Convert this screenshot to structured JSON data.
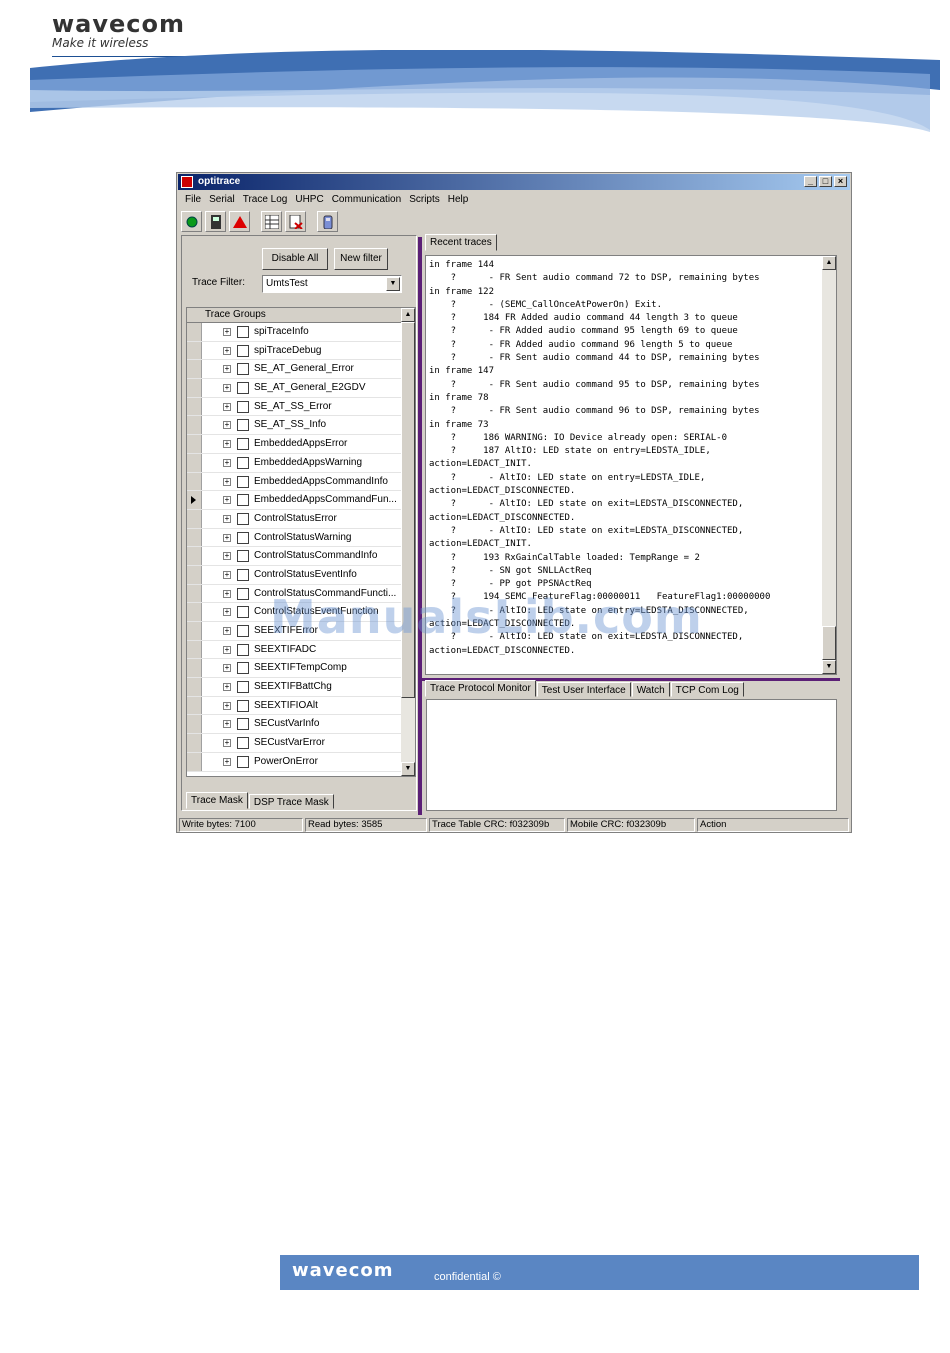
{
  "page": {
    "logo_text": "wavecom",
    "logo_tagline": "Make it wireless",
    "footer_logo": "wavecom",
    "footer_text": "confidential ©",
    "watermark": "ManualsLib.com"
  },
  "window": {
    "title": "optitrace",
    "controls": [
      "_",
      "□",
      "×"
    ],
    "menu": [
      "File",
      "Serial",
      "Trace Log",
      "UHPC",
      "Communication",
      "Scripts",
      "Help"
    ],
    "toolbar_icons": [
      "connect-icon",
      "mobile-icon",
      "warning-icon",
      "grid-icon",
      "clear-log-icon",
      "phone-icon"
    ]
  },
  "left_panel": {
    "disable_all": "Disable All",
    "new_filter": "New filter",
    "trace_filter_label": "Trace Filter:",
    "trace_filter_value": "UmtsTest",
    "tree_header": "Trace Groups",
    "groups": [
      "spiTraceInfo",
      "spiTraceDebug",
      "SE_AT_General_Error",
      "SE_AT_General_E2GDV",
      "SE_AT_SS_Error",
      "SE_AT_SS_Info",
      "EmbeddedAppsError",
      "EmbeddedAppsWarning",
      "EmbeddedAppsCommandInfo",
      "EmbeddedAppsCommandFun...",
      "ControlStatusError",
      "ControlStatusWarning",
      "ControlStatusCommandInfo",
      "ControlStatusEventInfo",
      "ControlStatusCommandFuncti...",
      "ControlStatusEventFunction",
      "SEEXTIFError",
      "SEEXTIFADC",
      "SEEXTIFTempComp",
      "SEEXTIFBattChg",
      "SEEXTIFIOAlt",
      "SECustVarInfo",
      "SECustVarError",
      "PowerOnError"
    ],
    "selected_index": 9,
    "tabs": [
      "Trace Mask",
      "DSP Trace Mask"
    ]
  },
  "right_panel": {
    "recent_tab": "Recent traces",
    "trace_lines": [
      "in frame 144",
      "    ?      - FR Sent audio command 72 to DSP, remaining bytes",
      "in frame 122",
      "    ?      - (SEMC_CallOnceAtPowerOn) Exit.",
      "    ?     184 FR Added audio command 44 length 3 to queue",
      "    ?      - FR Added audio command 95 length 69 to queue",
      "    ?      - FR Added audio command 96 length 5 to queue",
      "    ?      - FR Sent audio command 44 to DSP, remaining bytes",
      "in frame 147",
      "    ?      - FR Sent audio command 95 to DSP, remaining bytes",
      "in frame 78",
      "    ?      - FR Sent audio command 96 to DSP, remaining bytes",
      "in frame 73",
      "    ?     186 WARNING: IO Device already open: SERIAL-0",
      "    ?     187 AltIO: LED state on entry=LEDSTA_IDLE,",
      "action=LEDACT_INIT.",
      "    ?      - AltIO: LED state on entry=LEDSTA_IDLE,",
      "action=LEDACT_DISCONNECTED.",
      "    ?      - AltIO: LED state on exit=LEDSTA_DISCONNECTED,",
      "action=LEDACT_DISCONNECTED.",
      "    ?      - AltIO: LED state on exit=LEDSTA_DISCONNECTED,",
      "action=LEDACT_INIT.",
      "    ?     193 RxGainCalTable loaded: TempRange = 2",
      "    ?      - SN got SNLLActReq",
      "    ?      - PP got PPSNActReq",
      "    ?     194 SEMC FeatureFlag:00000011   FeatureFlag1:00000000",
      "    ?      - AltIO: LED state on entry=LEDSTA_DISCONNECTED,",
      "action=LEDACT_DISCONNECTED.",
      "    ?      - AltIO: LED state on exit=LEDSTA_DISCONNECTED,",
      "action=LEDACT_DISCONNECTED."
    ],
    "bottom_tabs": [
      "Trace Protocol Monitor",
      "Test User Interface",
      "Watch",
      "TCP Com Log"
    ]
  },
  "status_bar": [
    "Write bytes: 7100",
    "Read bytes: 3585",
    "Trace Table CRC: f032309b",
    "Mobile CRC: f032309b",
    "Action"
  ],
  "colors": {
    "window_face": "#d4d0c8",
    "titlebar_start": "#0a246a",
    "divider": "#5b1f76",
    "header_blue": "#1d4f93",
    "footer_blue": "#5a86c3"
  }
}
